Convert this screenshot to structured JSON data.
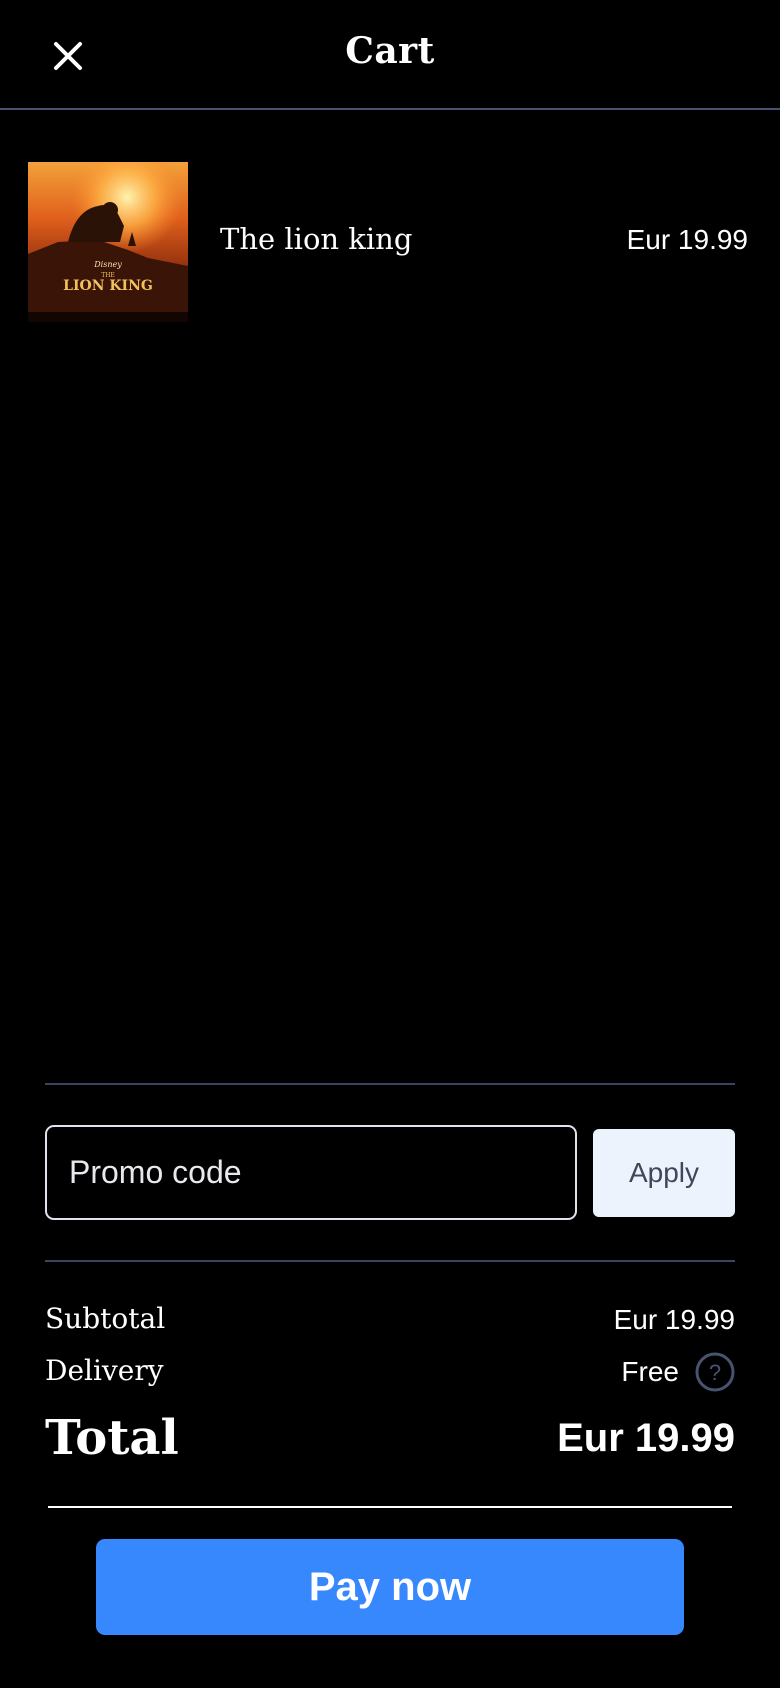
{
  "header": {
    "title": "Cart",
    "close_icon": "close-icon"
  },
  "cart": {
    "items": [
      {
        "name": "The lion king",
        "price": "Eur 19.99",
        "thumbnail": {
          "top_text": "Disney",
          "the_text": "THE",
          "title_text": "LION KING"
        }
      }
    ]
  },
  "promo": {
    "placeholder": "Promo code",
    "value": "",
    "apply_label": "Apply"
  },
  "summary": {
    "subtotal_label": "Subtotal",
    "subtotal_value": "Eur 19.99",
    "delivery_label": "Delivery",
    "delivery_value": "Free",
    "delivery_help_icon": "help-circle-icon",
    "total_label": "Total",
    "total_value": "Eur 19.99"
  },
  "checkout": {
    "pay_label": "Pay now"
  },
  "colors": {
    "background": "#000000",
    "divider": "#3c4462",
    "accent": "#3787fd",
    "apply_button_bg": "#edf3fd"
  }
}
